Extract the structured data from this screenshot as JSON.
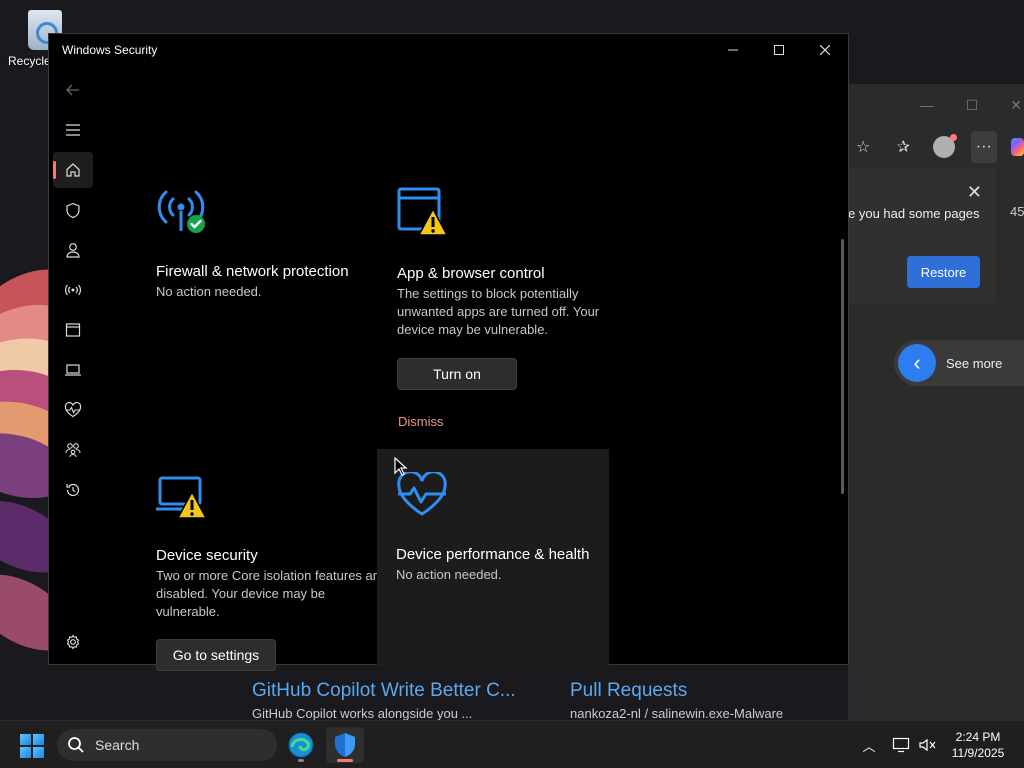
{
  "desktop": {
    "recycle_bin_label": "Recycle"
  },
  "edge": {
    "restore_message": "e you had some pages",
    "restore_button": "Restore",
    "side_number": "45",
    "see_more": "See more",
    "links": [
      {
        "title": "GitHub Copilot Write Better C...",
        "subtitle": "GitHub Copilot works alongside you ..."
      },
      {
        "title": "Pull Requests",
        "subtitle": "nankoza2-nl / salinewin.exe-Malware"
      }
    ]
  },
  "window": {
    "title": "Windows Security",
    "accent_color": "#f47b6f"
  },
  "nav": {
    "items": [
      {
        "name": "back-arrow-icon",
        "icon": "back-arrow"
      },
      {
        "name": "hamburger-menu-icon",
        "icon": "hamburger"
      },
      {
        "name": "home-icon",
        "icon": "home",
        "active": true
      },
      {
        "name": "shield-icon",
        "icon": "shield"
      },
      {
        "name": "person-icon",
        "icon": "person"
      },
      {
        "name": "wireless-icon",
        "icon": "wireless"
      },
      {
        "name": "browser-window-icon",
        "icon": "browser-window"
      },
      {
        "name": "laptop-icon",
        "icon": "laptop"
      },
      {
        "name": "heart-pulse-icon",
        "icon": "heart-pulse"
      },
      {
        "name": "family-icon",
        "icon": "family"
      },
      {
        "name": "history-icon",
        "icon": "history"
      },
      {
        "name": "settings-gear-icon",
        "icon": "gear"
      }
    ]
  },
  "tiles": {
    "firewall": {
      "title": "Firewall & network protection",
      "status": "No action needed.",
      "icon": "wireless-check-icon"
    },
    "app_browser": {
      "title": "App & browser control",
      "description": "The settings to block potentially unwanted apps are turned off. Your device may be vulnerable.",
      "button": "Turn on",
      "dismiss": "Dismiss",
      "icon": "browser-warning-icon"
    },
    "device_security": {
      "title": "Device security",
      "description": "Two or more Core isolation features are disabled.  Your device may be vulnerable.",
      "button": "Go to settings",
      "icon": "laptop-warning-icon"
    },
    "device_performance": {
      "title": "Device performance & health",
      "status": "No action needed.",
      "icon": "heart-pulse-icon"
    }
  },
  "taskbar": {
    "search_placeholder": "Search",
    "time": "2:24 PM",
    "date": "11/9/2025"
  }
}
